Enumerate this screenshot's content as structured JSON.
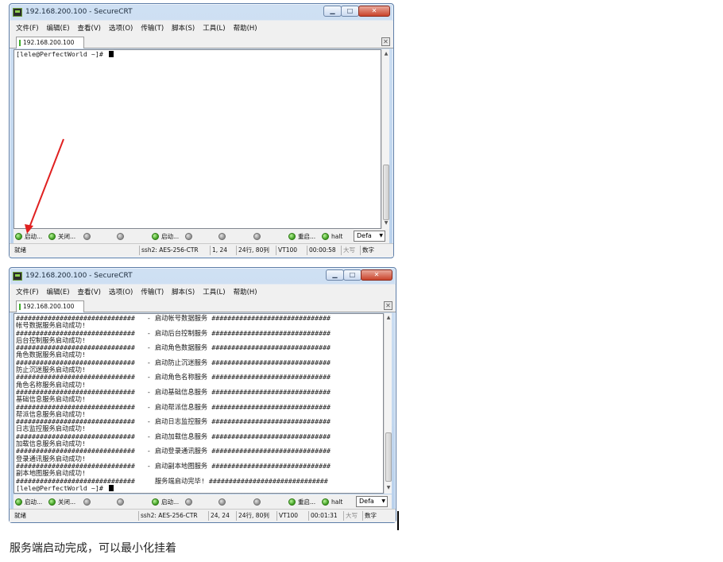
{
  "windows": [
    {
      "title": "192.168.200.100 - SecureCRT",
      "menu": [
        "文件(F)",
        "编辑(E)",
        "查看(V)",
        "选项(O)",
        "传输(T)",
        "脚本(S)",
        "工具(L)",
        "帮助(H)"
      ],
      "tab_label": "192.168.200.100",
      "terminal_lines": [
        "[lele@PerfectWorld ~]# "
      ],
      "buttons": [
        {
          "label": "启动...",
          "color": "green"
        },
        {
          "label": "关闭...",
          "color": "green"
        },
        {
          "label": "",
          "color": "gray"
        },
        {
          "label": "",
          "color": "gray"
        },
        {
          "label": "启动...",
          "color": "green"
        },
        {
          "label": "",
          "color": "gray"
        },
        {
          "label": "",
          "color": "gray"
        },
        {
          "label": "",
          "color": "gray"
        },
        {
          "label": "重启...",
          "color": "green"
        },
        {
          "label": "halt",
          "color": "green"
        }
      ],
      "dropdown": "Defa",
      "status": {
        "ready": "就绪",
        "cipher": "ssh2: AES-256-CTR",
        "position": "1, 24",
        "size": "24行, 80列",
        "term": "VT100",
        "time": "00:00:58",
        "caps": "大写",
        "num": "数字"
      }
    },
    {
      "title": "192.168.200.100 - SecureCRT",
      "menu": [
        "文件(F)",
        "编辑(E)",
        "查看(V)",
        "选项(O)",
        "传输(T)",
        "脚本(S)",
        "工具(L)",
        "帮助(H)"
      ],
      "tab_label": "192.168.200.100",
      "terminal_lines": [
        "##############################   - 启动帐号数据服务 ##############################",
        "帐号数据服务启动成功!",
        "##############################   - 启动后台控制服务 ##############################",
        "后台控制服务启动成功!",
        "##############################   - 启动角色数据服务 ##############################",
        "角色数据服务启动成功!",
        "##############################   - 启动防止沉迷服务 ##############################",
        "防止沉迷服务启动成功!",
        "##############################   - 启动角色名称服务 ##############################",
        "角色名称服务启动成功!",
        "##############################   - 启动基础信息服务 ##############################",
        "基础信息服务启动成功!",
        "##############################   - 启动帮派信息服务 ##############################",
        "帮派信息服务启动成功!",
        "##############################   - 启动日志监控服务 ##############################",
        "日志监控服务启动成功!",
        "##############################   - 启动加载信息服务 ##############################",
        "加载信息服务启动成功!",
        "##############################   - 启动登录通讯服务 ##############################",
        "登录通讯服务启动成功!",
        "##############################   - 启动副本地图服务 ##############################",
        "副本地图服务启动成功!",
        "##############################     服务端启动完毕! ##############################",
        "[lele@PerfectWorld ~]# "
      ],
      "buttons": [
        {
          "label": "启动...",
          "color": "green"
        },
        {
          "label": "关闭...",
          "color": "green"
        },
        {
          "label": "",
          "color": "gray"
        },
        {
          "label": "",
          "color": "gray"
        },
        {
          "label": "启动...",
          "color": "green"
        },
        {
          "label": "",
          "color": "gray"
        },
        {
          "label": "",
          "color": "gray"
        },
        {
          "label": "",
          "color": "gray"
        },
        {
          "label": "重启...",
          "color": "green"
        },
        {
          "label": "halt",
          "color": "green"
        }
      ],
      "dropdown": "Defa",
      "status": {
        "ready": "就绪",
        "cipher": "ssh2: AES-256-CTR",
        "position": "24, 24",
        "size": "24行, 80列",
        "term": "VT100",
        "time": "00:01:31",
        "caps": "大写",
        "num": "数字"
      }
    }
  ],
  "caption": "服务端启动完成，可以最小化挂着",
  "colors": {
    "annotation_arrow": "#e02020",
    "status_green": "#3c9b1e"
  }
}
